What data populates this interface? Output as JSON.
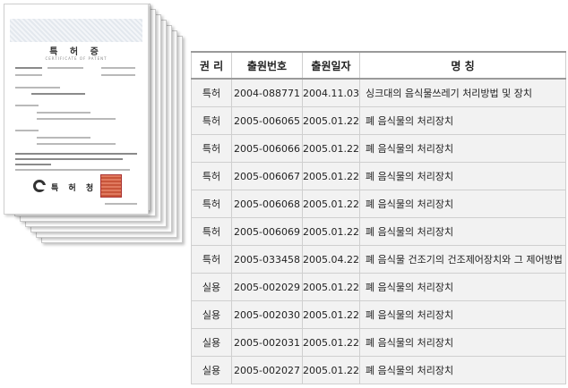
{
  "certificate": {
    "title": "특 허 증",
    "subtitle": "CERTIFICATE OF PATENT",
    "issuer": "특 허 청"
  },
  "table": {
    "headers": [
      "권 리",
      "출원번호",
      "출원일자",
      "명    칭"
    ],
    "rows": [
      {
        "type": "특허",
        "number": "2004-088771",
        "date": "2004.11.03",
        "name": "싱크대의 음식물쓰레기 처리방법 및 장치"
      },
      {
        "type": "특허",
        "number": "2005-006065",
        "date": "2005.01.22",
        "name": "폐 음식물의 처리장치"
      },
      {
        "type": "특허",
        "number": "2005-006066",
        "date": "2005.01.22",
        "name": "폐 음식물의 처리장치"
      },
      {
        "type": "특허",
        "number": "2005-006067",
        "date": "2005.01.22",
        "name": "폐 음식물의 처리장치"
      },
      {
        "type": "특허",
        "number": "2005-006068",
        "date": "2005.01.22",
        "name": "폐 음식물의 처리장치"
      },
      {
        "type": "특허",
        "number": "2005-006069",
        "date": "2005.01.22",
        "name": "폐 음식물의 처리장치"
      },
      {
        "type": "특허",
        "number": "2005-033458",
        "date": "2005.04.22",
        "name": "폐 음식물 건조기의 건조제어장치와 그 제어방법"
      },
      {
        "type": "실용",
        "number": "2005-002029",
        "date": "2005.01.22",
        "name": "폐 음식물의 처리장치"
      },
      {
        "type": "실용",
        "number": "2005-002030",
        "date": "2005.01.22",
        "name": "폐 음식물의 처리장치"
      },
      {
        "type": "실용",
        "number": "2005-002031",
        "date": "2005.01.22",
        "name": "폐 음식물의 처리장치"
      },
      {
        "type": "실용",
        "number": "2005-002027",
        "date": "2005.01.22",
        "name": "폐 음식물의 처리장치"
      }
    ]
  }
}
